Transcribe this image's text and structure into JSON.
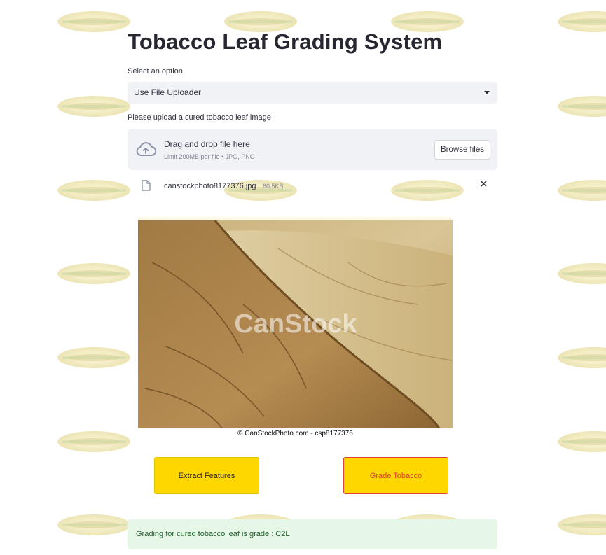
{
  "page": {
    "title": "Tobacco Leaf Grading System"
  },
  "select": {
    "label": "Select an option",
    "value": "Use File Uploader"
  },
  "uploader": {
    "label": "Please upload a cured tobacco leaf image",
    "drop_title": "Drag and drop file here",
    "drop_limit": "Limit 200MB per file • JPG, PNG",
    "browse_label": "Browse files",
    "file_name": "canstockphoto8177376.jpg",
    "file_size": "60.5KB",
    "remove_symbol": "✕"
  },
  "preview": {
    "watermark": "CanStock",
    "caption": "© CanStockPhoto.com - csp8177376"
  },
  "actions": {
    "extract_label": "Extract Features",
    "grade_label": "Grade Tobacco"
  },
  "result": {
    "text": "Grading for cured tobacco leaf is grade : C2L"
  },
  "colors": {
    "accent_yellow": "#ffd700",
    "grade_text": "#e23a2c",
    "success_bg": "#e6f7e8"
  }
}
